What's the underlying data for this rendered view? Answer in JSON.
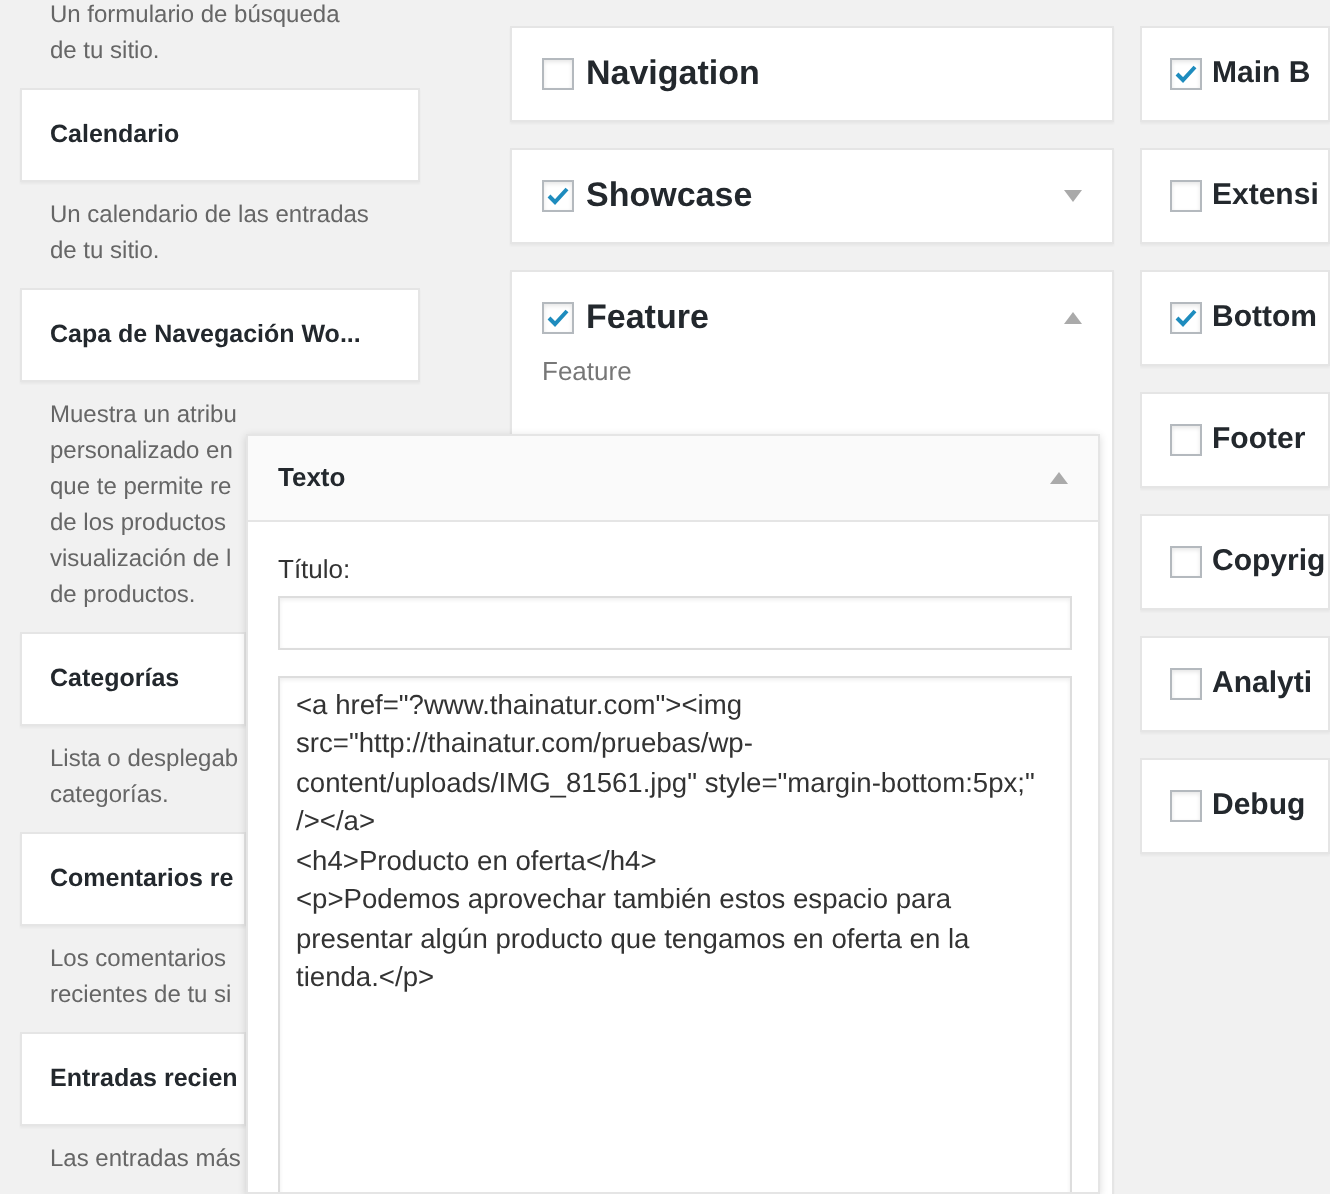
{
  "available_widgets": [
    {
      "description": [
        "Un formulario de búsqueda",
        "de tu sitio."
      ]
    },
    {
      "title": "Calendario",
      "description": [
        "Un calendario de las entradas",
        "de tu sitio."
      ]
    },
    {
      "title": "Capa de Navegación Wo...",
      "description": [
        "Muestra un atribu",
        "personalizado en",
        "que te permite re",
        "de los productos",
        "visualización de l",
        "de productos."
      ]
    },
    {
      "title": "Categorías",
      "description": [
        "Lista o desplegab",
        "categorías."
      ]
    },
    {
      "title": "Comentarios re",
      "description": [
        "Los comentarios",
        "recientes de tu si"
      ]
    },
    {
      "title": "Entradas recien",
      "description": [
        "Las entradas más"
      ]
    }
  ],
  "sidebars_middle": [
    {
      "name": "Navigation",
      "checked": false
    },
    {
      "name": "Showcase",
      "checked": true,
      "expanded": false
    },
    {
      "name": "Feature",
      "checked": true,
      "expanded": true,
      "description": "Feature"
    }
  ],
  "sidebars_right": [
    {
      "name": "Main B",
      "checked": true
    },
    {
      "name": "Extensi",
      "checked": false
    },
    {
      "name": "Bottom",
      "checked": true
    },
    {
      "name": "Footer",
      "checked": false
    },
    {
      "name": "Copyrig",
      "checked": false
    },
    {
      "name": "Analyti",
      "checked": false
    },
    {
      "name": "Debug",
      "checked": false
    }
  ],
  "dragged_widget": {
    "title": "Texto",
    "expanded": true,
    "title_label": "Título:",
    "content": "<a href=\"?www.thainatur.com\"><img src=\"http://thainatur.com/pruebas/wp-content/uploads/IMG_81561.jpg\" style=\"margin-bottom:5px;\" /></a>\n<h4>Producto en oferta</h4>\n<p>Podemos aprovechar también estos espacio para presentar algún producto que tengamos en oferta en la tienda.</p>"
  }
}
